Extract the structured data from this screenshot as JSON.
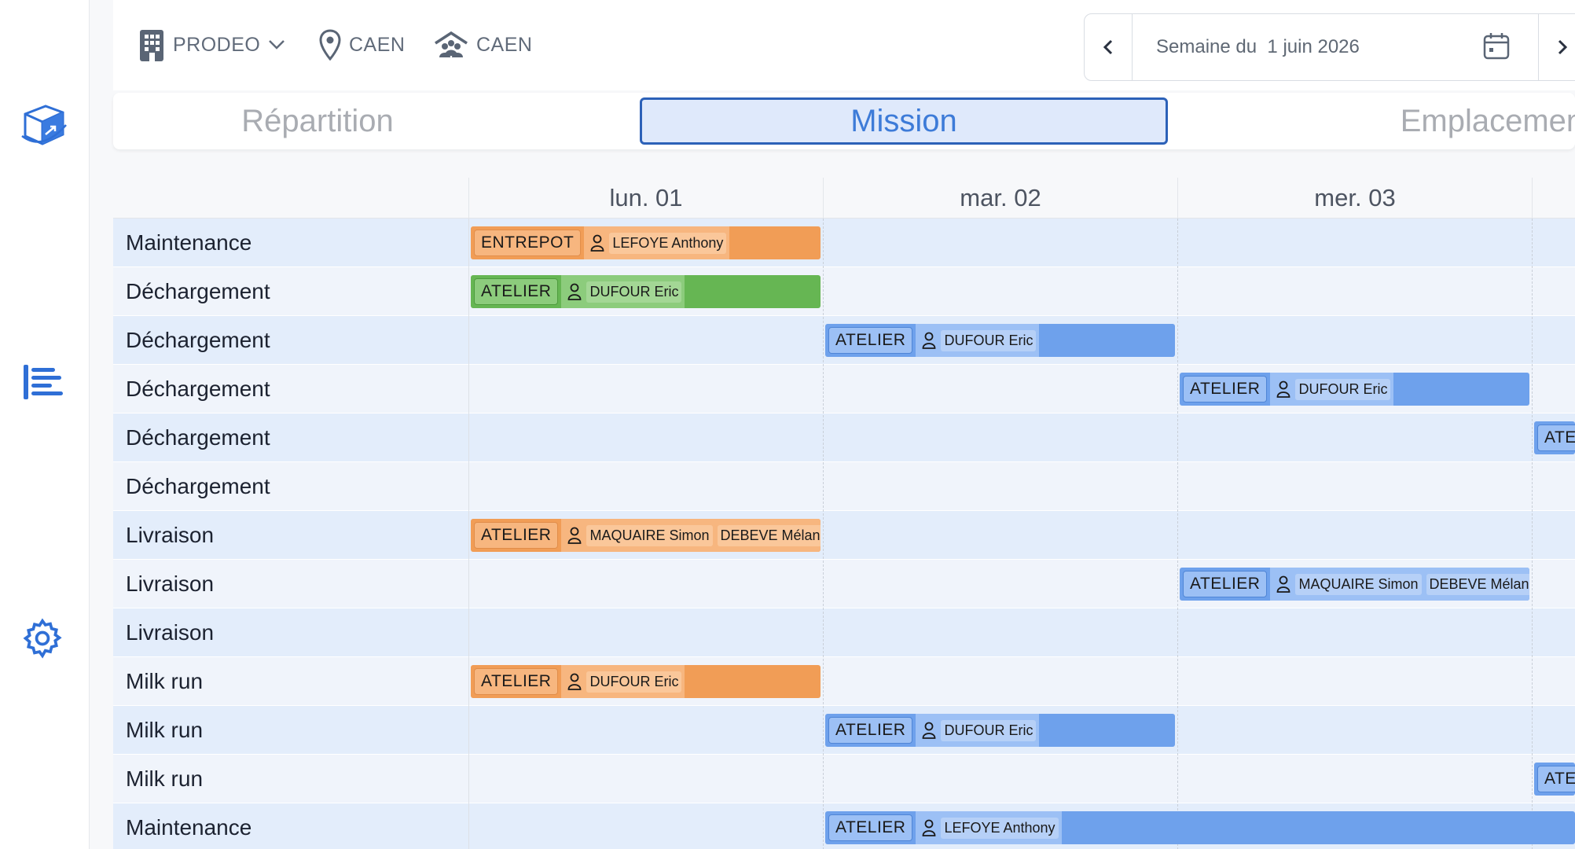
{
  "filters": {
    "company": "PRODEO",
    "location": "CAEN",
    "site": "CAEN"
  },
  "week_picker": {
    "label": "Semaine du  1 juin 2026"
  },
  "tabs": [
    {
      "label": "Répartition",
      "active": false
    },
    {
      "label": "Mission",
      "active": true
    },
    {
      "label": "Emplacement",
      "active": false
    }
  ],
  "days": [
    "lun. 01",
    "mar. 02",
    "mer. 03"
  ],
  "rows": [
    {
      "label": "Maintenance"
    },
    {
      "label": "Déchargement"
    },
    {
      "label": "Déchargement"
    },
    {
      "label": "Déchargement"
    },
    {
      "label": "Déchargement"
    },
    {
      "label": "Déchargement"
    },
    {
      "label": "Livraison"
    },
    {
      "label": "Livraison"
    },
    {
      "label": "Livraison"
    },
    {
      "label": "Milk run"
    },
    {
      "label": "Milk run"
    },
    {
      "label": "Milk run"
    },
    {
      "label": "Maintenance"
    }
  ],
  "missions": [
    {
      "row": 0,
      "tag": "ENTREPOT",
      "people": [
        "LEFOYE Anthony"
      ],
      "color": "#f19d56"
    },
    {
      "row": 1,
      "tag": "ATELIER",
      "people": [
        "DUFOUR Eric"
      ],
      "color": "#66b653"
    },
    {
      "row": 2,
      "tag": "ATELIER",
      "people": [
        "DUFOUR Eric"
      ],
      "color": "#6ea1ec"
    },
    {
      "row": 3,
      "tag": "ATELIER",
      "people": [
        "DUFOUR Eric"
      ],
      "color": "#6ea1ec"
    },
    {
      "row": 4,
      "tag": "ATEL",
      "people": [],
      "color": "#6ea1ec"
    },
    {
      "row": 6,
      "tag": "ATELIER",
      "people": [
        "MAQUAIRE Simon",
        "DEBEVE Mélani"
      ],
      "color": "#f19d56"
    },
    {
      "row": 7,
      "tag": "ATELIER",
      "people": [
        "MAQUAIRE Simon",
        "DEBEVE Mélani"
      ],
      "color": "#6ea1ec"
    },
    {
      "row": 9,
      "tag": "ATELIER",
      "people": [
        "DUFOUR Eric"
      ],
      "color": "#f19d56"
    },
    {
      "row": 10,
      "tag": "ATELIER",
      "people": [
        "DUFOUR Eric"
      ],
      "color": "#6ea1ec"
    },
    {
      "row": 11,
      "tag": "ATEL",
      "people": [],
      "color": "#6ea1ec"
    },
    {
      "row": 12,
      "tag": "ATELIER",
      "people": [
        "LEFOYE Anthony"
      ],
      "color": "#6ea1ec"
    }
  ],
  "colors": {
    "accent": "#2c61b8",
    "orange": "#f19d56",
    "green": "#66b653",
    "blue": "#6ea1ec"
  }
}
